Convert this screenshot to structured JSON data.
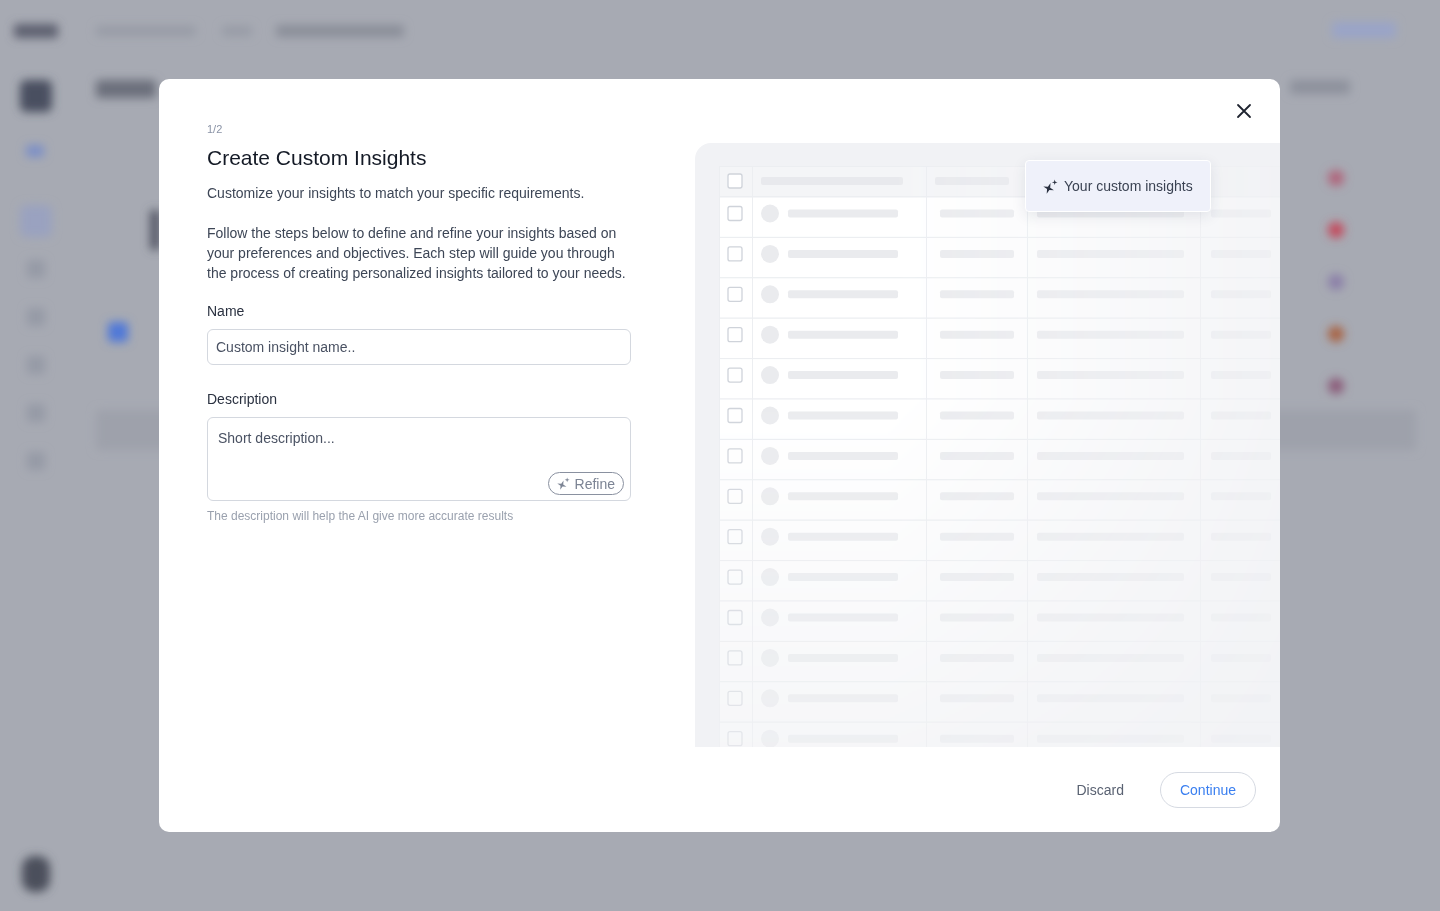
{
  "dialog": {
    "step": "1/2",
    "title": "Create Custom Insights",
    "paragraphs": [
      "Customize your insights to match your specific requirements.",
      "Follow the steps below to define and refine your insights based on your preferences and objectives. Each step will guide you through the process of creating personalized insights tailored to your needs."
    ],
    "fields": [
      {
        "kind": "input",
        "label": "Name",
        "placeholder": "Custom insight name.."
      },
      {
        "kind": "textarea",
        "label": "Description",
        "placeholder": "Short description...",
        "action": "Refine",
        "help": "The description will help the AI give more accurate results"
      }
    ],
    "preview": {
      "tooltip": "Your custom insights"
    },
    "buttons": [
      {
        "kind": "secondary",
        "label": "Discard"
      },
      {
        "kind": "primary",
        "label": "Continue"
      }
    ]
  }
}
